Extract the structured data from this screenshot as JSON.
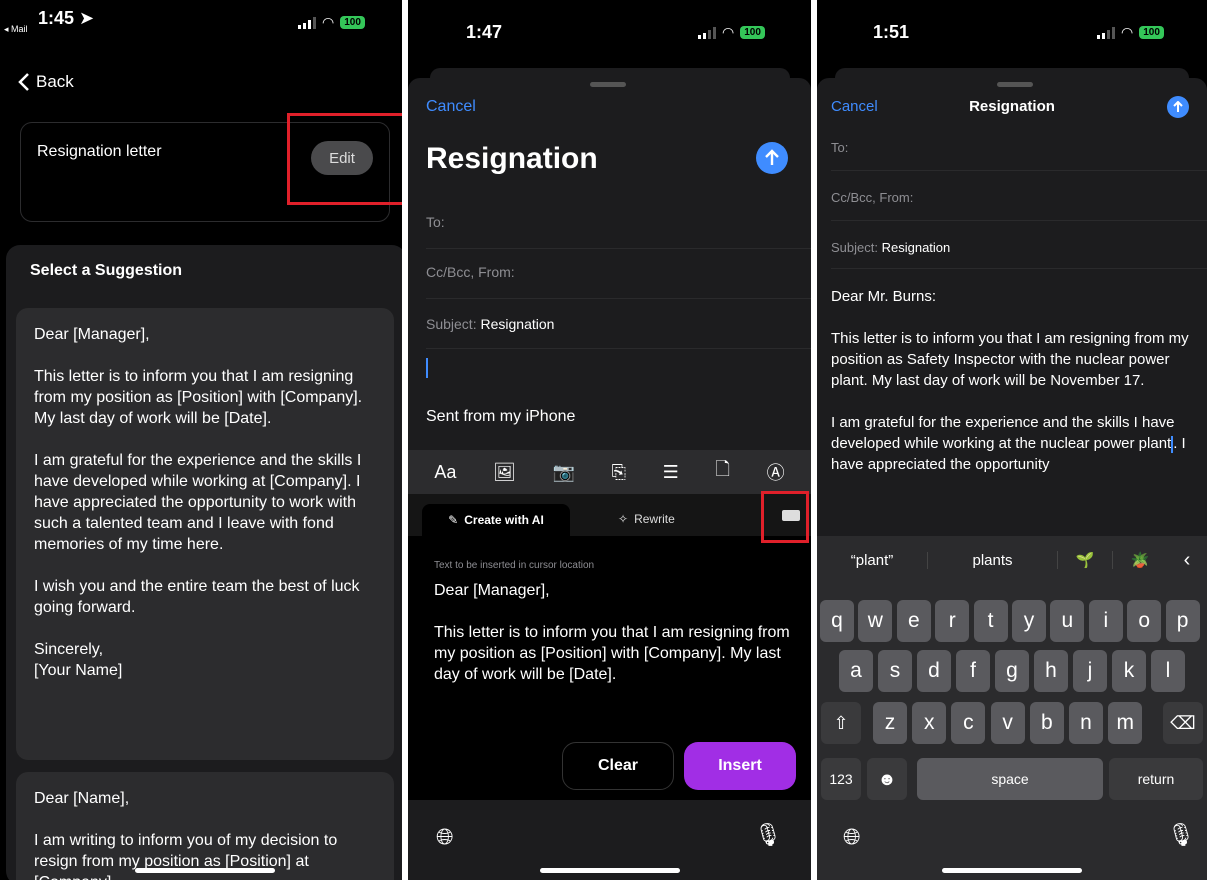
{
  "panel1": {
    "status": {
      "time": "1:45",
      "back_app": "◂ Mail",
      "battery": "100"
    },
    "back_label": "Back",
    "prompt": "Resignation letter",
    "edit_label": "Edit",
    "section_title": "Select a Suggestion",
    "suggestion1": "Dear [Manager],\n\nThis letter is to inform you that I am resigning from my position as [Position] with [Company]. My last day of work will be [Date].\n\nI am grateful for the experience and the skills I have developed while working at [Company]. I have appreciated the opportunity to work with such a talented team and I leave with fond memories of my time here.\n\nI wish you and the entire team the best of luck going forward.\n\nSincerely,\n[Your Name]",
    "suggestion2": "Dear [Name],\n\nI am writing to inform you of my decision to resign from my position as [Position] at [Company]."
  },
  "panel2": {
    "status": {
      "time": "1:47",
      "battery": "100"
    },
    "cancel": "Cancel",
    "title": "Resignation",
    "to_label": "To:",
    "cc_label": "Cc/Bcc, From:",
    "subject_label": "Subject:",
    "subject_value": "Resignation",
    "signature": "Sent from my iPhone",
    "toolbar_aa": "Aa",
    "tab_create": "Create with AI",
    "tab_rewrite": "Rewrite",
    "hint": "Text to be inserted in cursor location",
    "insert_text": "Dear [Manager],\n\nThis letter is to inform you that I am resigning from my position as [Position] with [Company]. My last day of work will be [Date].",
    "clear": "Clear",
    "insert": "Insert"
  },
  "panel3": {
    "status": {
      "time": "1:51",
      "battery": "100"
    },
    "cancel": "Cancel",
    "title": "Resignation",
    "to_label": "To:",
    "cc_label": "Cc/Bcc, From:",
    "subject_label": "Subject:",
    "subject_value": "Resignation",
    "greeting": "Dear Mr. Burns:",
    "para1": "This letter is to inform you that I am resigning from my position as Safety Inspector with the nuclear power plant. My last day of work will be November 17.",
    "para2_a": "I am grateful for the experience and the skills I have developed while working at the nuclear power plant",
    "para2_b": ". I have appreciated the opportunity",
    "suggest1": "“plant”",
    "suggest2": "plants",
    "suggest3": "🌱",
    "suggest4": "🪴",
    "row1": [
      "q",
      "w",
      "e",
      "r",
      "t",
      "y",
      "u",
      "i",
      "o",
      "p"
    ],
    "row2": [
      "a",
      "s",
      "d",
      "f",
      "g",
      "h",
      "j",
      "k",
      "l"
    ],
    "row3": [
      "z",
      "x",
      "c",
      "v",
      "b",
      "n",
      "m"
    ],
    "key_123": "123",
    "key_space": "space",
    "key_return": "return"
  }
}
